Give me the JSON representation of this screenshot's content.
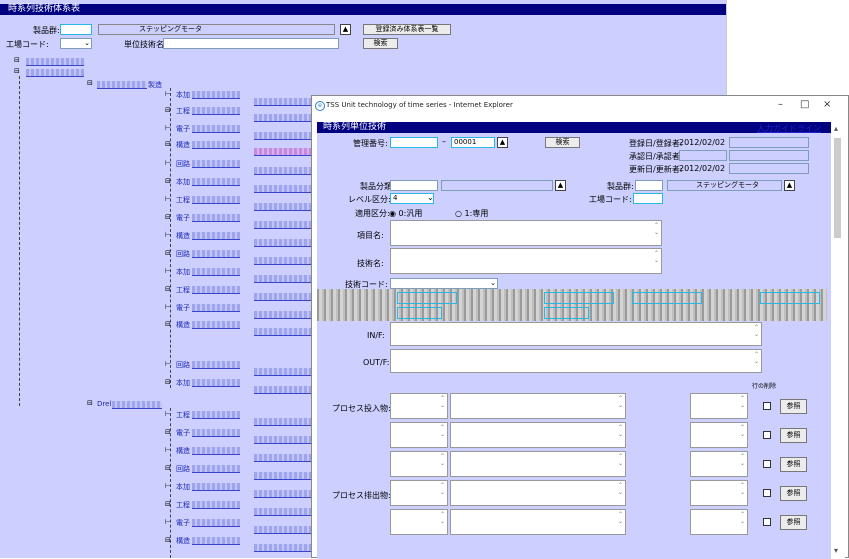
{
  "bg": {
    "title": "時系列技術体系表",
    "product_label": "製品群:",
    "product_value": "ステッピングモータ",
    "factory_label": "工場コード:",
    "unit_label": "単位技術名:",
    "list_button": "登録済み体系表一覧",
    "search_button": "検索",
    "tree_node_1": "製造",
    "tree_node_2": "Drel"
  },
  "fg": {
    "window_title": "TSS Unit technology of time series - Internet Explorer",
    "header": "時系列単位技術",
    "guide_link": "入力ガイドライン",
    "mgmt_label": "管理番号:",
    "mgmt_value": "00001",
    "search_button": "検索",
    "reg_label": "登録日/登録者:",
    "reg_value": "2012/02/02",
    "approve_label": "承認日/承認者:",
    "update_label": "更新日/更新者:",
    "update_value": "2012/02/02",
    "product_class_label": "製品分類:",
    "product_group_label": "製品群:",
    "product_group_value": "ステッピングモータ",
    "level_label": "レベル区分:",
    "level_value": "4",
    "factory_label": "工場コード:",
    "apply_label": "適用区分:",
    "apply_opt1": "0:汎用",
    "apply_opt2": "1:専用",
    "item_label": "項目名:",
    "tech_label": "技術名:",
    "tech_code_label": "技術コード:",
    "input_label": "IN/F:",
    "output_label": "OUT/F:",
    "delete_label": "行の削除",
    "proc_in_label": "プロセス投入物:",
    "proc_out_label": "プロセス排出物:",
    "ref_button": "参照"
  },
  "tree_prefixes": [
    "本加",
    "工程",
    "電子",
    "構造",
    "回路"
  ]
}
